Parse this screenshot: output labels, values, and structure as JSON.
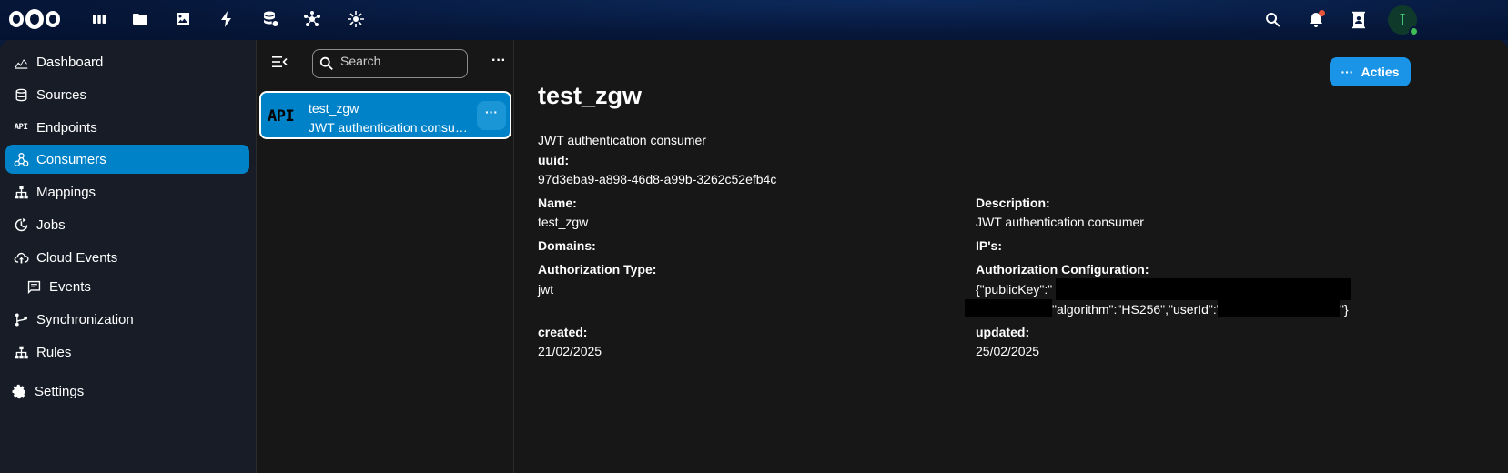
{
  "topbar": {
    "apps": [
      "dashboard-icon",
      "files-icon",
      "photos-icon",
      "activity-icon",
      "database-icon",
      "network-icon",
      "gear-app-icon"
    ],
    "avatar_letter": "I"
  },
  "nav": {
    "items": [
      {
        "label": "Dashboard",
        "icon": "chart-icon"
      },
      {
        "label": "Sources",
        "icon": "database-icon"
      },
      {
        "label": "Endpoints",
        "icon": "api-icon",
        "icon_text": "API"
      },
      {
        "label": "Consumers",
        "icon": "consumers-icon",
        "active": true
      },
      {
        "label": "Mappings",
        "icon": "sitemap-icon"
      },
      {
        "label": "Jobs",
        "icon": "clock-icon"
      },
      {
        "label": "Cloud Events",
        "icon": "cloud-icon"
      },
      {
        "label": "Events",
        "icon": "message-icon",
        "sub": true
      },
      {
        "label": "Synchronization",
        "icon": "sync-icon"
      },
      {
        "label": "Rules",
        "icon": "sitemap-icon"
      },
      {
        "label": "Settings",
        "icon": "cog-icon"
      }
    ]
  },
  "list": {
    "search_placeholder": "Search",
    "item": {
      "icon_text": "API",
      "title": "test_zgw",
      "subtitle": "JWT authentication consumer"
    }
  },
  "detail": {
    "actions_label": "Acties",
    "title": "test_zgw",
    "description_line": "JWT authentication consumer",
    "uuid_label": "uuid:",
    "uuid_value": "97d3eba9-a898-46d8-a99b-3262c52efb4c",
    "name_label": "Name:",
    "name_value": "test_zgw",
    "description_label": "Description:",
    "description_value": "JWT authentication consumer",
    "domains_label": "Domains:",
    "ips_label": "IP's:",
    "auth_type_label": "Authorization Type:",
    "auth_type_value": "jwt",
    "auth_config_label": "Authorization Configuration:",
    "auth_config_line1": "{\"publicKey\":\"",
    "auth_config_line2": "\"algorithm\":\"HS256\",\"userId\":\"",
    "auth_config_end": "\"}",
    "created_label": "created:",
    "created_value": "21/02/2025",
    "updated_label": "updated:",
    "updated_value": "25/02/2025"
  }
}
